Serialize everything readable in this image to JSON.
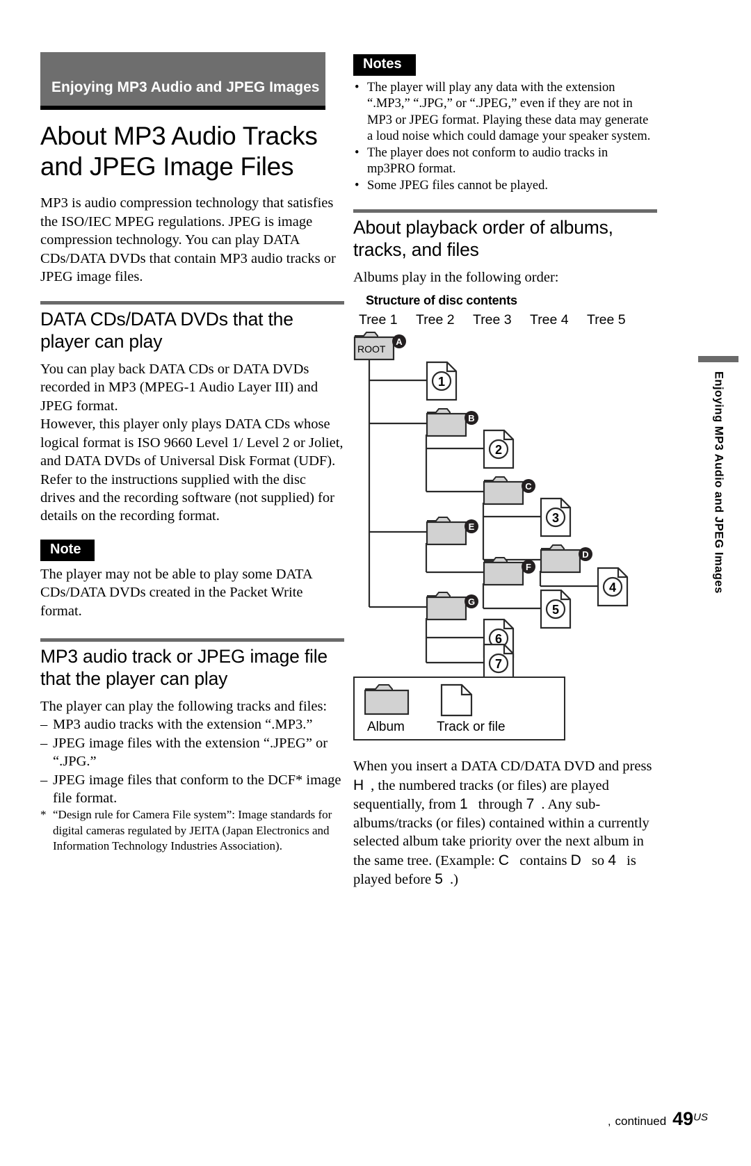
{
  "chapter": {
    "banner_title": "Enjoying MP3 Audio and JPEG Images",
    "side_tab_label": "Enjoying MP3 Audio and JPEG Images"
  },
  "left": {
    "main_title": "About MP3 Audio Tracks and JPEG Image Files",
    "intro_paragraph": "MP3 is audio compression technology that satisfies the ISO/IEC MPEG regulations. JPEG is image compression technology. You can play DATA CDs/DATA DVDs that contain MP3 audio tracks or JPEG image files.",
    "section1": {
      "heading": "DATA CDs/DATA DVDs that the player can play",
      "paragraphs": [
        "You can play back DATA CDs or DATA DVDs recorded in MP3 (MPEG-1 Audio Layer III) and JPEG format.",
        "However, this player only plays DATA CDs whose logical format is ISO 9660 Level 1/ Level 2 or Joliet, and DATA DVDs of Universal Disk Format (UDF).",
        "Refer to the instructions supplied with the disc drives and the recording software (not supplied) for details on the recording format."
      ],
      "note_badge": "Note",
      "note_text": "The player may not be able to play some DATA CDs/DATA DVDs created in the Packet Write format."
    },
    "section2": {
      "heading": "MP3 audio track or JPEG image file that the player can play",
      "intro": "The player can play the following tracks and files:",
      "items": [
        "MP3 audio tracks with the extension “.MP3.”",
        "JPEG image files with the extension “.JPEG” or “.JPG.”",
        "JPEG image files that conform to the DCF* image file format."
      ],
      "footnote_marker": "*",
      "footnote_text": "“Design rule for Camera File system”: Image standards for digital cameras regulated by JEITA (Japan Electronics and Information Technology Industries Association)."
    }
  },
  "right": {
    "notes_badge": "Notes",
    "notes": [
      "The player will play any data with the extension “.MP3,” “.JPG,” or “.JPEG,” even if they are not in MP3 or JPEG format. Playing these data may generate a loud noise which could damage your speaker system.",
      "The player does not conform to audio tracks in mp3PRO format.",
      "Some JPEG files cannot be played."
    ],
    "section": {
      "heading": "About playback order of albums, tracks, and files",
      "intro": "Albums play in the following order:",
      "sub_heading": "Structure of disc contents"
    },
    "tree": {
      "column_headers": [
        "Tree 1",
        "Tree 2",
        "Tree 3",
        "Tree 4",
        "Tree 5"
      ],
      "root_label": "ROOT",
      "folders": [
        "A",
        "B",
        "C",
        "D",
        "E",
        "F",
        "G"
      ],
      "files": [
        "1",
        "2",
        "3",
        "4",
        "5",
        "6",
        "7"
      ]
    },
    "legend": {
      "album_label": "Album",
      "file_label": "Track or file"
    },
    "closing_paragraph_parts": {
      "p1": "When you insert a DATA CD/DATA DVD and press ",
      "key_play": "H",
      "p2": ", the numbered tracks (or files) are played sequentially, from ",
      "num_first": "1",
      "p3": " through ",
      "num_last": "7",
      "p4": ". Any sub-albums/tracks (or files) contained within a currently selected album take priority over the next album in the same tree. (Example: ",
      "letter_c": "C",
      "p5": " contains ",
      "letter_d": "D",
      "p6": " so ",
      "num_4": "4",
      "p7": " is played before ",
      "num_5": "5",
      "p8": ".)"
    }
  },
  "footer": {
    "arrow": ",",
    "continued": "continued",
    "page_number": "49",
    "region": "US"
  }
}
